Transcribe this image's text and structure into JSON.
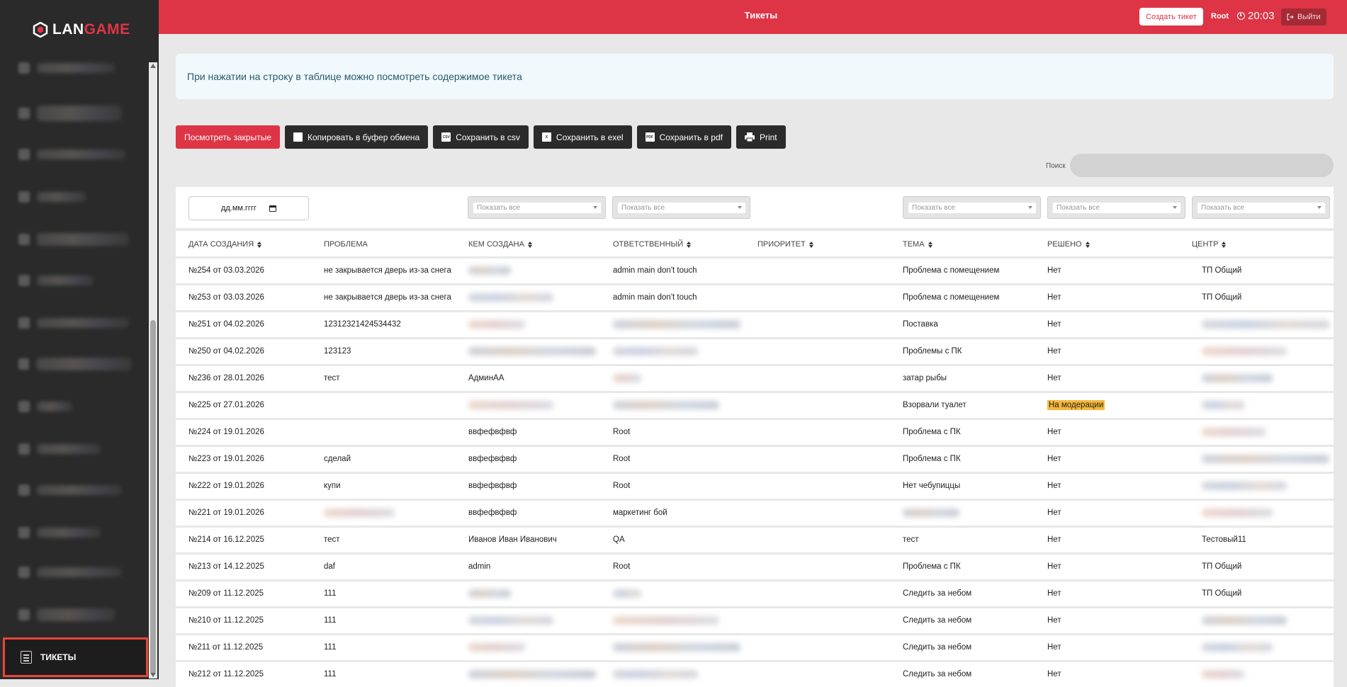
{
  "app": {
    "logo_prefix": "LAN",
    "logo_accent": "GAME",
    "brand_color": "#dd3545"
  },
  "sidebar": {
    "active_item": {
      "label": "ТИКЕТЫ",
      "icon": "document-icon"
    }
  },
  "header": {
    "title": "Тикеты",
    "create_button": "Создать тикет",
    "user": "Root",
    "time": "20:03",
    "exit_button": "Выйти"
  },
  "info": {
    "text": "При нажатии на строку в таблице можно посмотреть содержимое тикета"
  },
  "toolbar": {
    "show_closed": "Посмотреть закрытые",
    "copy": "Копировать в буфер обмена",
    "csv": "Сохранить в csv",
    "excel": "Сохранить в exel",
    "pdf": "Сохранить в pdf",
    "print": "Print"
  },
  "search": {
    "label": "Поиск",
    "value": ""
  },
  "filters": {
    "date_placeholder": "дд.мм.гггг",
    "select_placeholder": "Показать все"
  },
  "table": {
    "columns": [
      "ДАТА СОЗДАНИЯ",
      "ПРОБЛЕМА",
      "КЕМ СОЗДАНА",
      "ОТВЕТСТВЕННЫЙ",
      "ПРИОРИТЕТ",
      "ТЕМА",
      "РЕШЕНО",
      "ЦЕНТР"
    ],
    "rows": [
      {
        "date": "№254 от 03.03.2026",
        "problem": "не закрывается дверь из-за снега",
        "creator": "",
        "responsible": "admin main don't touch",
        "priority": "",
        "topic": "Проблема с помещением",
        "solved": "Нет",
        "center": "ТП Общий"
      },
      {
        "date": "№253 от 03.03.2026",
        "problem": "не закрывается дверь из-за снега",
        "creator": "",
        "responsible": "admin main don't touch",
        "priority": "",
        "topic": "Проблема с помещением",
        "solved": "Нет",
        "center": "ТП Общий"
      },
      {
        "date": "№251 от 04.02.2026",
        "problem": "12312321424534432",
        "creator": "",
        "responsible": "",
        "priority": "",
        "topic": "Поставка",
        "solved": "Нет",
        "center": ""
      },
      {
        "date": "№250 от 04.02.2026",
        "problem": "123123",
        "creator": "",
        "responsible": "",
        "priority": "",
        "topic": "Проблемы с ПК",
        "solved": "Нет",
        "center": ""
      },
      {
        "date": "№236 от 28.01.2026",
        "problem": "тест",
        "creator": "АдминАА",
        "responsible": "",
        "priority": "",
        "topic": "затар рыбы",
        "solved": "Нет",
        "center": ""
      },
      {
        "date": "№225 от 27.01.2026",
        "problem": "",
        "creator": "",
        "responsible": "",
        "priority": "",
        "topic": "Взорвали туалет",
        "solved": "На модерации",
        "center": ""
      },
      {
        "date": "№224 от 19.01.2026",
        "problem": "",
        "creator": "ввфефвфвф",
        "responsible": "Root",
        "priority": "",
        "topic": "Проблема с ПК",
        "solved": "Нет",
        "center": ""
      },
      {
        "date": "№223 от 19.01.2026",
        "problem": "сделай",
        "creator": "ввфефвфвф",
        "responsible": "Root",
        "priority": "",
        "topic": "Проблема с ПК",
        "solved": "Нет",
        "center": ""
      },
      {
        "date": "№222 от 19.01.2026",
        "problem": "купи",
        "creator": "ввфефвфвф",
        "responsible": "Root",
        "priority": "",
        "topic": "Нет чебупиццы",
        "solved": "Нет",
        "center": ""
      },
      {
        "date": "№221 от 19.01.2026",
        "problem": "",
        "creator": "ввфефвфвф",
        "responsible": "маркетинг бой",
        "priority": "",
        "topic": "",
        "solved": "Нет",
        "center": ""
      },
      {
        "date": "№214 от 16.12.2025",
        "problem": "тест",
        "creator": "Иванов Иван Иванович",
        "responsible": "QA",
        "priority": "",
        "topic": "тест",
        "solved": "Нет",
        "center": "Тестовый11"
      },
      {
        "date": "№213 от 14.12.2025",
        "problem": "daf",
        "creator": "admin",
        "responsible": "Root",
        "priority": "",
        "topic": "Проблема с ПК",
        "solved": "Нет",
        "center": "ТП Общий"
      },
      {
        "date": "№209 от 11.12.2025",
        "problem": "111",
        "creator": "",
        "responsible": "",
        "priority": "",
        "topic": "Следить за небом",
        "solved": "Нет",
        "center": "ТП Общий"
      },
      {
        "date": "№210 от 11.12.2025",
        "problem": "111",
        "creator": "",
        "responsible": "",
        "priority": "",
        "topic": "Следить за небом",
        "solved": "Нет",
        "center": ""
      },
      {
        "date": "№211 от 11.12.2025",
        "problem": "111",
        "creator": "",
        "responsible": "",
        "priority": "",
        "topic": "Следить за небом",
        "solved": "Нет",
        "center": ""
      },
      {
        "date": "№212 от 11.12.2025",
        "problem": "111",
        "creator": "",
        "responsible": "",
        "priority": "",
        "topic": "Следить за небом",
        "solved": "Нет",
        "center": ""
      }
    ]
  }
}
